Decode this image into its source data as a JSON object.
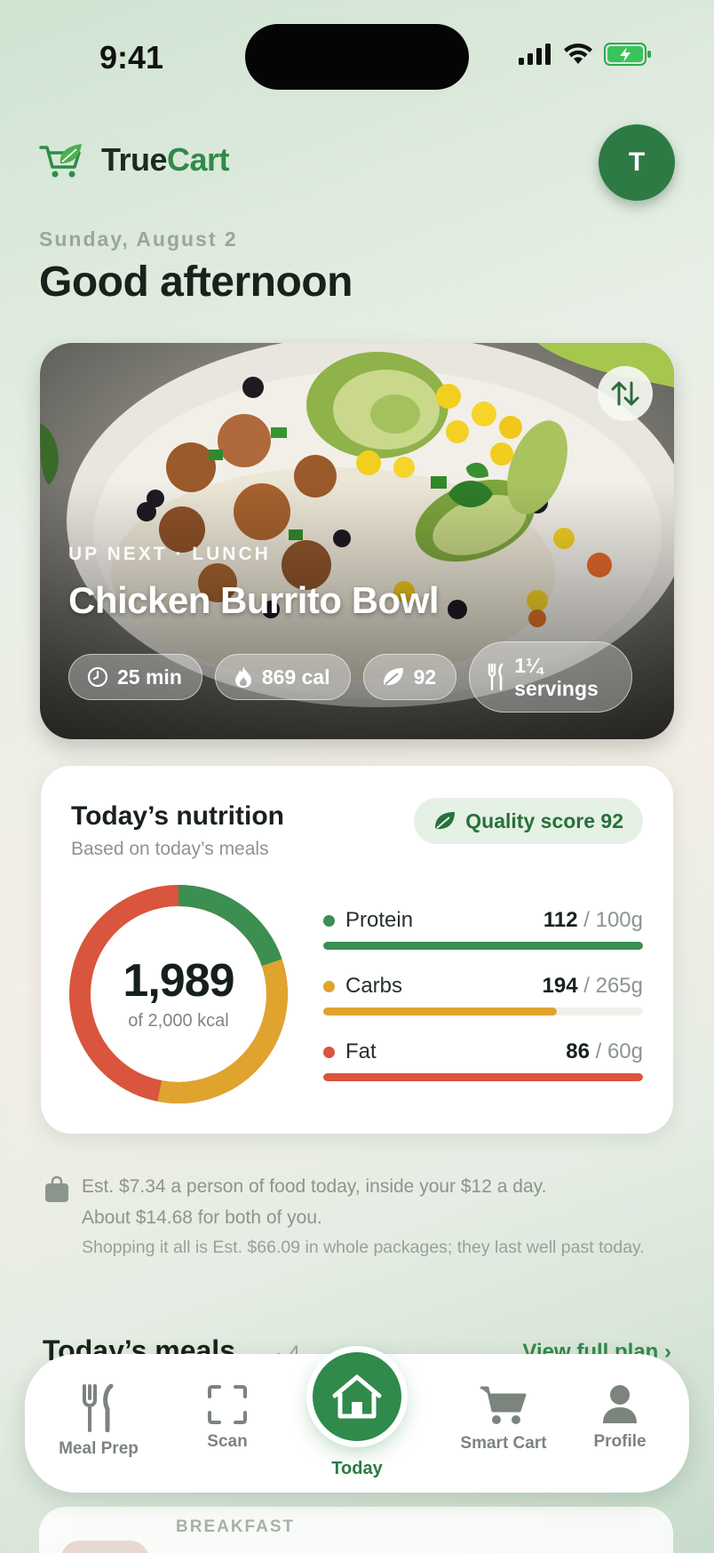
{
  "status_bar": {
    "time": "9:41"
  },
  "header": {
    "brand_part1": "True",
    "brand_part2": "Cart",
    "avatar_initial": "T"
  },
  "date": "Sunday, August 2",
  "greeting": "Good afternoon",
  "hero": {
    "eyebrow": "UP NEXT · LUNCH",
    "title": "Chicken Burrito Bowl",
    "chips": {
      "time": "25 min",
      "calories": "869 cal",
      "score": "92",
      "servings": "1¼ servings"
    }
  },
  "nutrition": {
    "title": "Today’s nutrition",
    "subtitle": "Based on today’s meals",
    "quality_badge": "Quality score 92",
    "kcal_value": "1,989",
    "kcal_goal": "of 2,000 kcal",
    "macros": [
      {
        "name": "Protein",
        "value": "112",
        "goal": " / 100g",
        "fill": 1.0,
        "color": "#3a8f51"
      },
      {
        "name": "Carbs",
        "value": "194",
        "goal": " / 265g",
        "fill": 0.73,
        "color": "#e0a32e"
      },
      {
        "name": "Fat",
        "value": "86",
        "goal": " / 60g",
        "fill": 1.0,
        "color": "#d9553d"
      }
    ]
  },
  "budget": {
    "line1": "Est. $7.34 a person of food today, inside your $12 a day.",
    "line2": "About $14.68 for both of you.",
    "line3": "Shopping it all is Est. $66.09 in whole packages; they last well past today."
  },
  "meals": {
    "title": "Today’s meals",
    "count": "· 4",
    "view_link": "View full plan ›",
    "first_label": "BREAKFAST"
  },
  "tabbar": {
    "meal_prep": "Meal Prep",
    "scan": "Scan",
    "today": "Today",
    "smart_cart": "Smart Cart",
    "profile": "Profile"
  },
  "colors": {
    "brand_green": "#2f8b4a",
    "protein": "#3a8f51",
    "carbs": "#e0a32e",
    "fat": "#d9553d"
  }
}
